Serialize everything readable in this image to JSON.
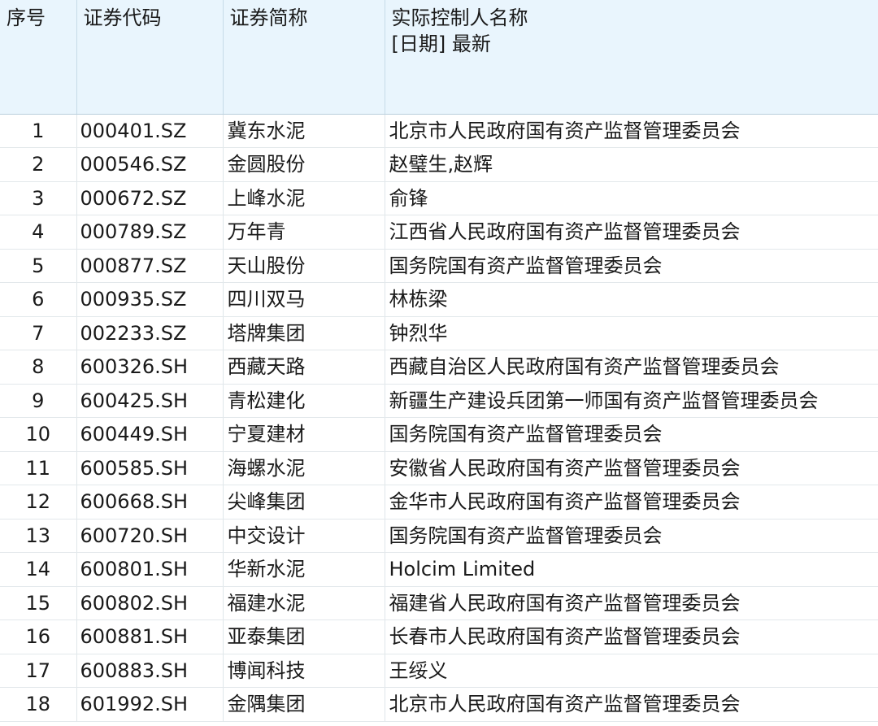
{
  "table": {
    "headers": {
      "index": "序号",
      "code": "证券代码",
      "name": "证券简称",
      "controller": "实际控制人名称",
      "controller_sub": "[日期] 最新"
    },
    "rows": [
      {
        "index": "1",
        "code": "000401.SZ",
        "name": "冀东水泥",
        "controller": "北京市人民政府国有资产监督管理委员会"
      },
      {
        "index": "2",
        "code": "000546.SZ",
        "name": "金圆股份",
        "controller": "赵璧生,赵辉"
      },
      {
        "index": "3",
        "code": "000672.SZ",
        "name": "上峰水泥",
        "controller": "俞锋"
      },
      {
        "index": "4",
        "code": "000789.SZ",
        "name": "万年青",
        "controller": "江西省人民政府国有资产监督管理委员会"
      },
      {
        "index": "5",
        "code": "000877.SZ",
        "name": "天山股份",
        "controller": "国务院国有资产监督管理委员会"
      },
      {
        "index": "6",
        "code": "000935.SZ",
        "name": "四川双马",
        "controller": "林栋梁"
      },
      {
        "index": "7",
        "code": "002233.SZ",
        "name": "塔牌集团",
        "controller": "钟烈华"
      },
      {
        "index": "8",
        "code": "600326.SH",
        "name": "西藏天路",
        "controller": "西藏自治区人民政府国有资产监督管理委员会"
      },
      {
        "index": "9",
        "code": "600425.SH",
        "name": "青松建化",
        "controller": "新疆生产建设兵团第一师国有资产监督管理委员会"
      },
      {
        "index": "10",
        "code": "600449.SH",
        "name": "宁夏建材",
        "controller": "国务院国有资产监督管理委员会"
      },
      {
        "index": "11",
        "code": "600585.SH",
        "name": "海螺水泥",
        "controller": "安徽省人民政府国有资产监督管理委员会"
      },
      {
        "index": "12",
        "code": "600668.SH",
        "name": "尖峰集团",
        "controller": "金华市人民政府国有资产监督管理委员会"
      },
      {
        "index": "13",
        "code": "600720.SH",
        "name": "中交设计",
        "controller": "国务院国有资产监督管理委员会"
      },
      {
        "index": "14",
        "code": "600801.SH",
        "name": "华新水泥",
        "controller": "Holcim Limited"
      },
      {
        "index": "15",
        "code": "600802.SH",
        "name": "福建水泥",
        "controller": "福建省人民政府国有资产监督管理委员会"
      },
      {
        "index": "16",
        "code": "600881.SH",
        "name": "亚泰集团",
        "controller": "长春市人民政府国有资产监督管理委员会"
      },
      {
        "index": "17",
        "code": "600883.SH",
        "name": "博闻科技",
        "controller": "王绥义"
      },
      {
        "index": "18",
        "code": "601992.SH",
        "name": "金隅集团",
        "controller": "北京市人民政府国有资产监督管理委员会"
      }
    ]
  }
}
